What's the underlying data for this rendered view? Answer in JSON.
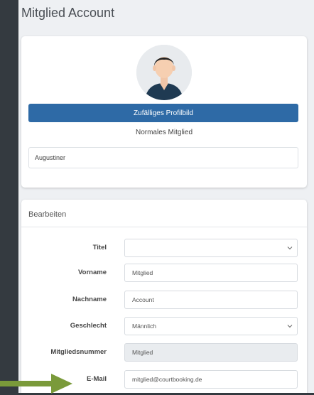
{
  "page": {
    "title": "Mitglied Account"
  },
  "profile": {
    "random_button_label": "Zufälliges Profilbild",
    "member_type": "Normales Mitglied",
    "username": "Augustiner"
  },
  "edit": {
    "header": "Bearbeiten",
    "fields": [
      {
        "label": "Titel",
        "value": "",
        "type": "select"
      },
      {
        "label": "Vorname",
        "value": "Mitglied",
        "type": "input"
      },
      {
        "label": "Nachname",
        "value": "Account",
        "type": "input"
      },
      {
        "label": "Geschlecht",
        "value": "Männlich",
        "type": "select"
      },
      {
        "label": "Mitgliedsnummer",
        "value": "Mitglied",
        "type": "disabled"
      },
      {
        "label": "E-Mail",
        "value": "mitglied@courtbooking.de",
        "type": "input"
      }
    ]
  },
  "colors": {
    "primary": "#2e6aa6",
    "sidebar": "#343a40",
    "arrow": "#7a9a3a"
  },
  "icons": [
    "avatar-person-icon",
    "chevron-down-icon",
    "arrow-right-icon"
  ]
}
